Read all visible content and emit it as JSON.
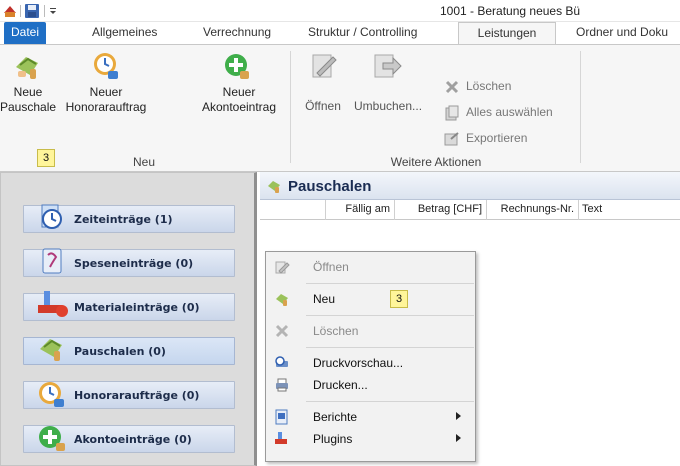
{
  "window": {
    "title": "1001 - Beratung neues Bü",
    "quick_access": [
      "app-icon",
      "save-icon",
      "customize-dropdown"
    ]
  },
  "tabs": [
    {
      "label": "Datei"
    },
    {
      "label": "Allgemeines"
    },
    {
      "label": "Verrechnung"
    },
    {
      "label": "Struktur / Controlling"
    },
    {
      "label": "Leistungen"
    },
    {
      "label": "Ordner und Doku"
    }
  ],
  "ribbon": {
    "group_neu": {
      "label": "Neu",
      "buttons": [
        {
          "label_line1": "Neue",
          "label_line2": "Pauschale",
          "icon": "pauschale-icon",
          "keytip": "3"
        },
        {
          "label_line1": "Neuer",
          "label_line2": "Honorarauftrag",
          "icon": "honorarauftrag-icon"
        },
        {
          "label_line1": "Neuer",
          "label_line2": "Akontoeintrag",
          "icon": "akontoeintrag-icon"
        }
      ]
    },
    "group_weitere": {
      "label": "Weitere Aktionen",
      "buttons": [
        {
          "label": "Öffnen",
          "icon": "open-icon"
        },
        {
          "label": "Umbuchen...",
          "icon": "rebook-icon"
        }
      ],
      "small_buttons": [
        {
          "label": "Löschen",
          "icon": "delete-icon"
        },
        {
          "label": "Alles auswählen",
          "icon": "select-all-icon"
        },
        {
          "label": "Exportieren",
          "icon": "export-icon"
        }
      ]
    }
  },
  "nav": {
    "items": [
      {
        "label": "Zeiteinträge (1)",
        "icon": "clock-icon"
      },
      {
        "label": "Speseneinträge (0)",
        "icon": "receipt-icon"
      },
      {
        "label": "Materialeinträge (0)",
        "icon": "material-icon"
      },
      {
        "label": "Pauschalen (0)",
        "icon": "pauschale-icon"
      },
      {
        "label": "Honoraraufträge (0)",
        "icon": "honorarauftrag-icon"
      },
      {
        "label": "Akontoeinträge (0)",
        "icon": "akontoeintrag-icon"
      }
    ],
    "active_index": 3
  },
  "panel": {
    "title": "Pauschalen",
    "columns": [
      "Fällig am",
      "Betrag [CHF]",
      "Rechnungs-Nr.",
      "Text"
    ]
  },
  "context_menu": {
    "items": [
      {
        "label": "Öffnen",
        "icon": "open-icon",
        "disabled": true
      },
      {
        "label": "Neu",
        "icon": "pauschale-icon",
        "keytip": "3"
      },
      {
        "label": "Löschen",
        "icon": "delete-icon",
        "disabled": true
      },
      {
        "label": "Druckvorschau...",
        "icon": "print-preview-icon"
      },
      {
        "label": "Drucken...",
        "icon": "printer-icon"
      },
      {
        "label": "Berichte",
        "icon": "reports-icon",
        "submenu": true
      },
      {
        "label": "Plugins",
        "icon": "plugins-icon",
        "submenu": true
      }
    ]
  },
  "colors": {
    "file_tab": "#1f6fc5",
    "ribbon_bg": "#f6f6f6",
    "nav_button": "#cad6ea",
    "keytip": "#fff59a"
  }
}
